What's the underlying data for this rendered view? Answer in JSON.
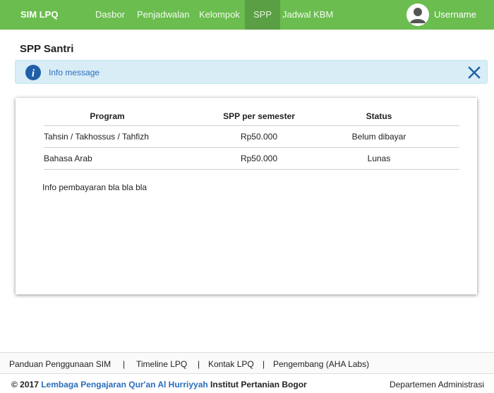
{
  "navbar": {
    "brand": "SIM LPQ",
    "items": [
      {
        "label": "Dasbor"
      },
      {
        "label": "Penjadwalan"
      },
      {
        "label": "Kelompok"
      },
      {
        "label": "SPP"
      },
      {
        "label": "Jadwal KBM"
      }
    ],
    "active_item": "SPP",
    "username": "Username",
    "colors": {
      "bar": "#6abd4e",
      "active": "#5a9f44"
    }
  },
  "page": {
    "title": "SPP Santri"
  },
  "alert": {
    "message": "Info message",
    "icon": "info-circle-icon",
    "close_icon": "close-x-icon",
    "colors": {
      "background": "#d9edf7",
      "text": "#2a6ebb"
    }
  },
  "table": {
    "headers": [
      "Program",
      "SPP per semester",
      "Status"
    ],
    "rows": [
      [
        "Tahsin / Takhossus / Tahfizh",
        "Rp50.000",
        "Belum dibayar"
      ],
      [
        "Bahasa Arab",
        "Rp50.000",
        "Lunas"
      ]
    ]
  },
  "payment_note": "Info pembayaran bla bla bla",
  "footer": {
    "links": [
      "Panduan Penggunaan SIM",
      "Timeline LPQ",
      "Kontak LPQ",
      "Pengembang (AHA Labs)"
    ],
    "separator": "|",
    "copyright_prefix": "© 2017",
    "org_link": "Lembaga Pengajaran Qur'an Al Hurriyyah",
    "institution": "Institut Pertanian Bogor",
    "department": "Departemen Administrasi"
  }
}
